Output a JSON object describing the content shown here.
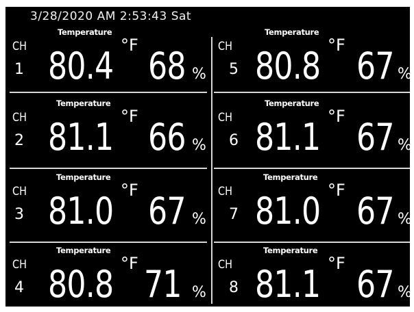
{
  "display": {
    "datetime": "3/28/2020  AM  2:53:43 Sat"
  },
  "channels": [
    {
      "ch_label": "CH",
      "number": "1",
      "temp_label": "Temperature",
      "temperature": "80.4",
      "unit": "°F",
      "humidity": "68",
      "humidity_unit": "%"
    },
    {
      "ch_label": "CH",
      "number": "2",
      "temp_label": "Temperature",
      "temperature": "81.1",
      "unit": "°F",
      "humidity": "66",
      "humidity_unit": "%"
    },
    {
      "ch_label": "CH",
      "number": "3",
      "temp_label": "Temperature",
      "temperature": "81.0",
      "unit": "°F",
      "humidity": "67",
      "humidity_unit": "%"
    },
    {
      "ch_label": "CH",
      "number": "4",
      "temp_label": "Temperature",
      "temperature": "80.8",
      "unit": "°F",
      "humidity": "71",
      "humidity_unit": "%"
    },
    {
      "ch_label": "CH",
      "number": "5",
      "temp_label": "Temperature",
      "temperature": "80.8",
      "unit": "°F",
      "humidity": "67",
      "humidity_unit": "%"
    },
    {
      "ch_label": "CH",
      "number": "6",
      "temp_label": "Temperature",
      "temperature": "81.1",
      "unit": "°F",
      "humidity": "67",
      "humidity_unit": "%"
    },
    {
      "ch_label": "CH",
      "number": "7",
      "temp_label": "Temperature",
      "temperature": "81.0",
      "unit": "°F",
      "humidity": "67",
      "humidity_unit": "%"
    },
    {
      "ch_label": "CH",
      "number": "8",
      "temp_label": "Temperature",
      "temperature": "81.1",
      "unit": "°F",
      "humidity": "67",
      "humidity_unit": "%"
    }
  ],
  "colors": {
    "background": "#000000",
    "text": "#ffffff",
    "divider": "#d8d8d8"
  }
}
